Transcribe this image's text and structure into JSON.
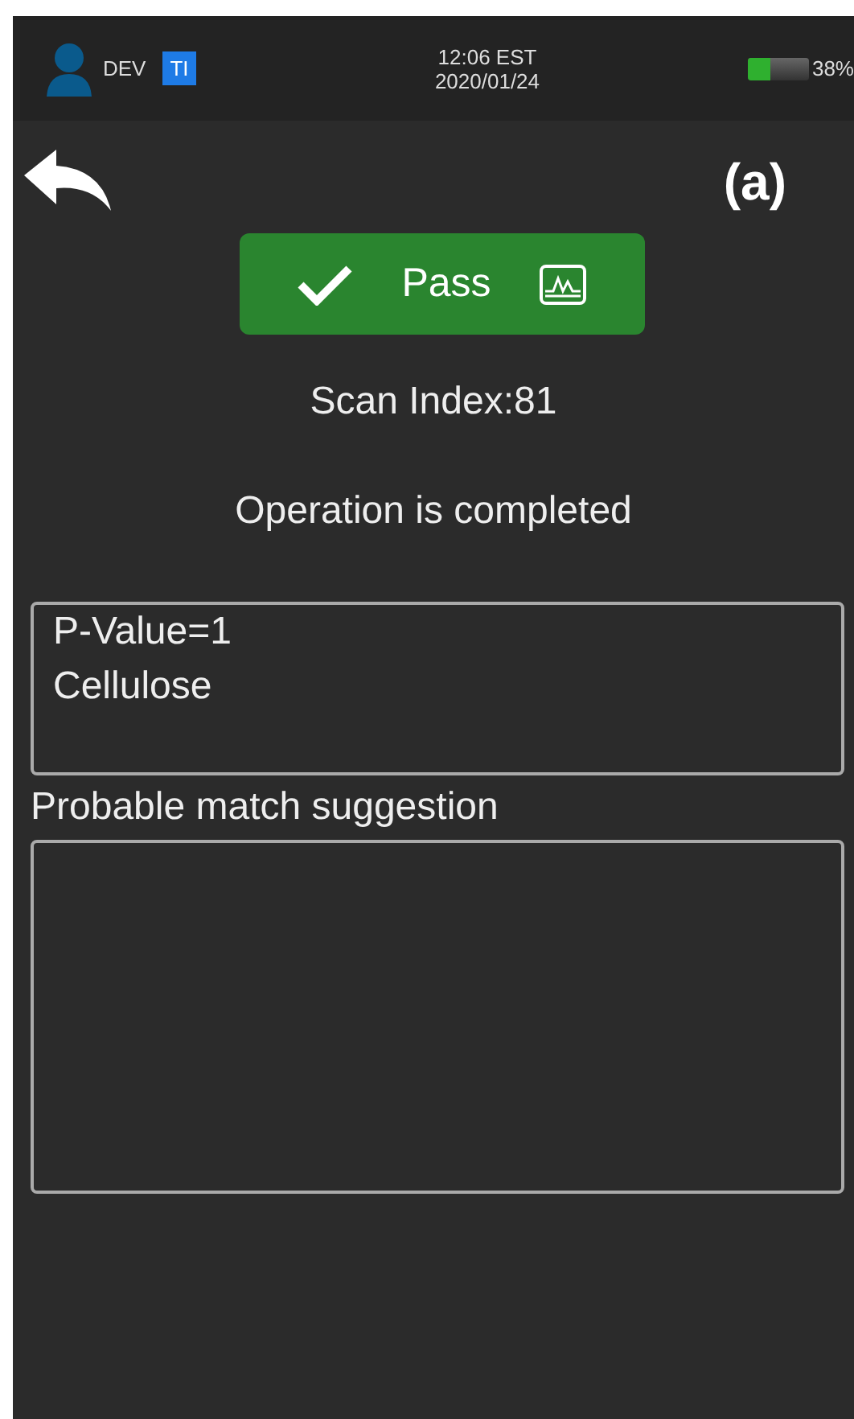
{
  "status_bar": {
    "user": "DEV",
    "badge": "TI",
    "time": "12:06 EST",
    "date": "2020/01/24",
    "battery": {
      "level": 0.38,
      "reading": "38%"
    }
  },
  "header": {
    "label": "(a)"
  },
  "result_button": {
    "label": "Pass"
  },
  "scan_index": "Scan Index:81",
  "message": "Operation is completed",
  "result_box": {
    "lines": [
      "P-Value=1",
      "Cellulose"
    ]
  },
  "suggestion": {
    "label": "Probable match suggestion"
  }
}
